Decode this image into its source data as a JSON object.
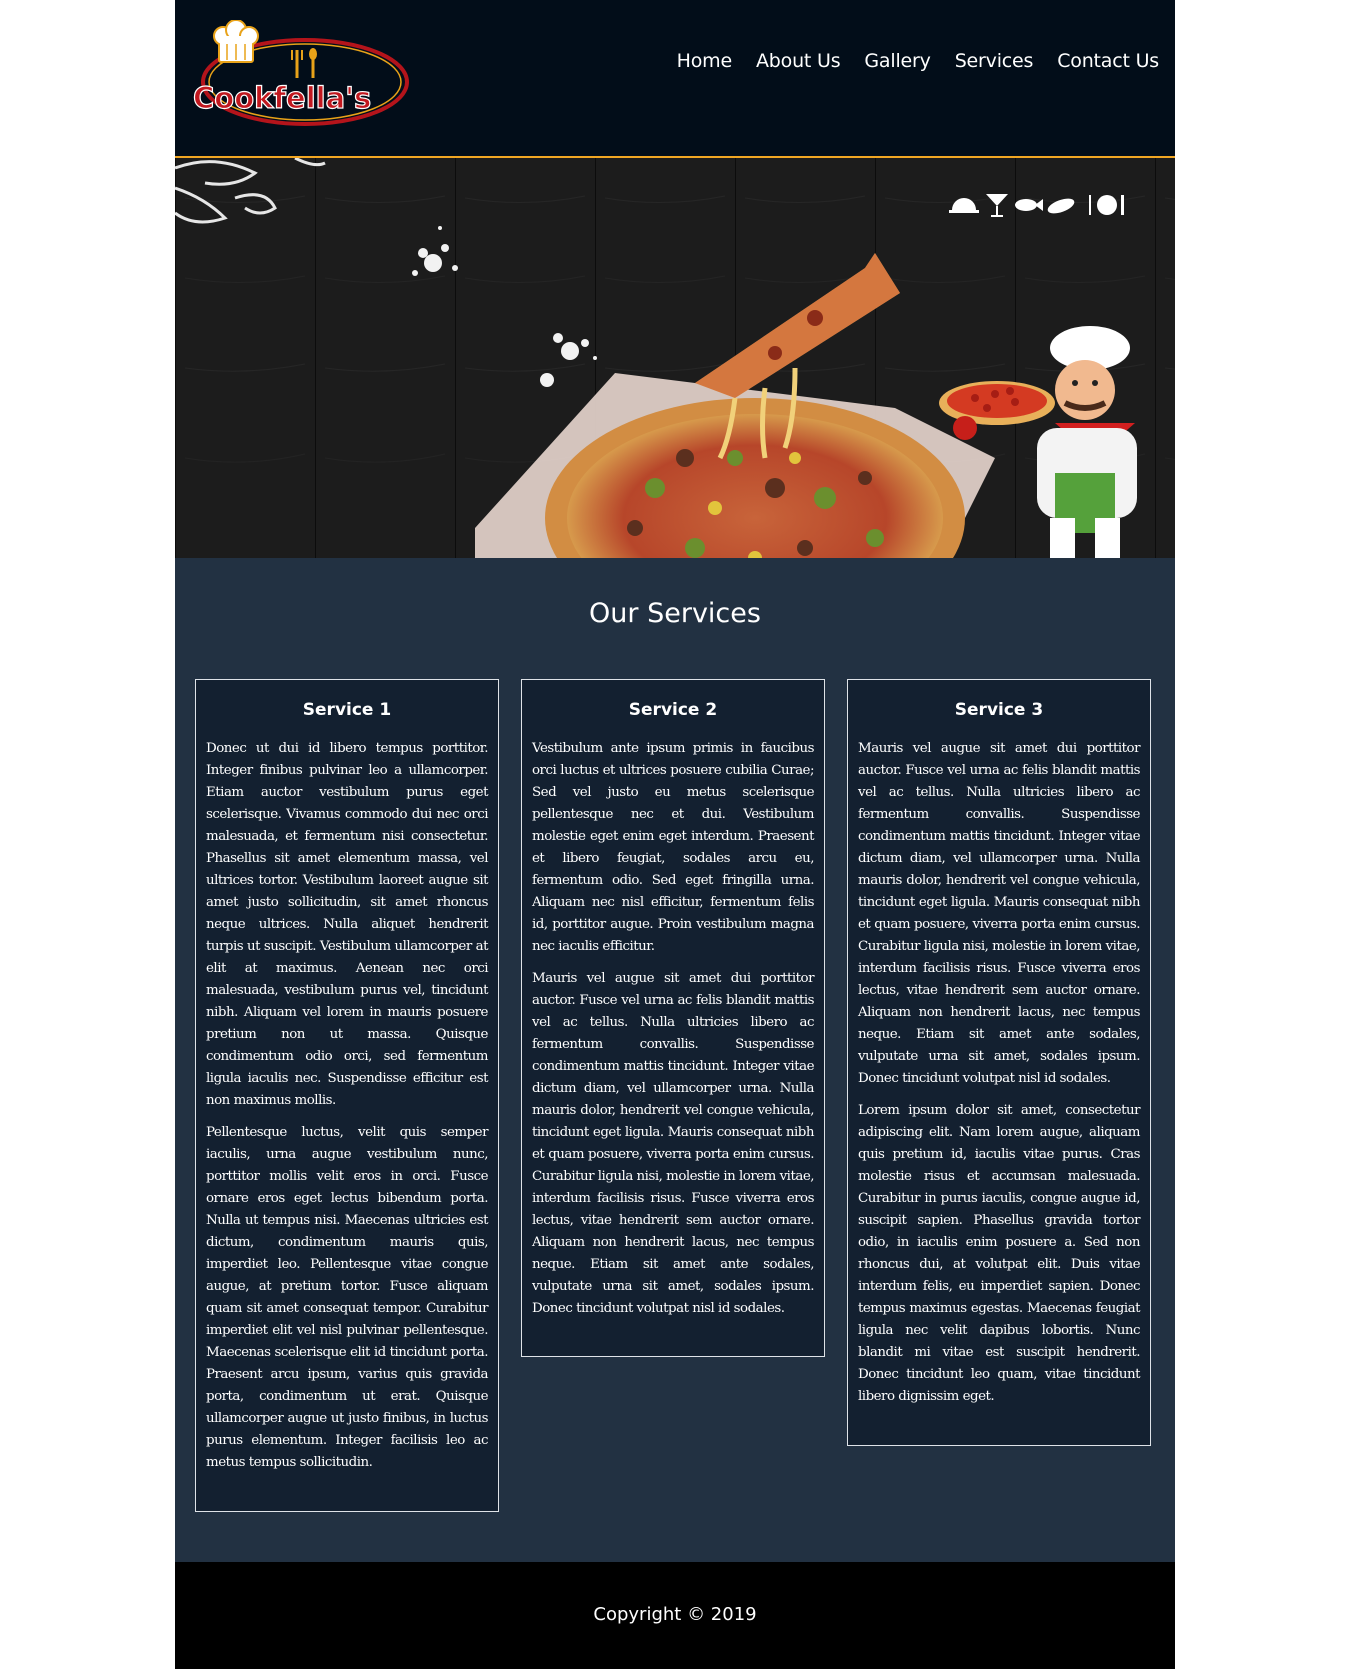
{
  "brand": {
    "logo_text": "Cookfella's"
  },
  "nav": {
    "items": [
      {
        "label": "Home"
      },
      {
        "label": "About Us"
      },
      {
        "label": "Gallery"
      },
      {
        "label": "Services"
      },
      {
        "label": "Contact Us"
      }
    ]
  },
  "hero": {
    "icons": [
      "cloche-icon",
      "cocktail-icon",
      "fish-icon",
      "leaf-dish-icon",
      "plate-cutlery-icon"
    ]
  },
  "services": {
    "title": "Our Services",
    "cards": [
      {
        "title": "Service 1",
        "paragraphs": [
          "Donec ut dui id libero tempus porttitor. Integer finibus pulvinar leo a ullamcorper. Etiam auctor vestibulum purus eget scelerisque. Vivamus commodo dui nec orci malesuada, et fermentum nisi consectetur. Phasellus sit amet elementum massa, vel ultrices tortor. Vestibulum laoreet augue sit amet justo sollicitudin, sit amet rhoncus neque ultrices. Nulla aliquet hendrerit turpis ut suscipit. Vestibulum ullamcorper at elit at maximus. Aenean nec orci malesuada, vestibulum purus vel, tincidunt nibh. Aliquam vel lorem in mauris posuere pretium non ut massa. Quisque condimentum odio orci, sed fermentum ligula iaculis nec. Suspendisse efficitur est non maximus mollis.",
          "Pellentesque luctus, velit quis semper iaculis, urna augue vestibulum nunc, porttitor mollis velit eros in orci. Fusce ornare eros eget lectus bibendum porta. Nulla ut tempus nisi. Maecenas ultricies est dictum, condimentum mauris quis, imperdiet leo. Pellentesque vitae congue augue, at pretium tortor. Fusce aliquam quam sit amet consequat tempor. Curabitur imperdiet elit vel nisl pulvinar pellentesque. Maecenas scelerisque elit id tincidunt porta. Praesent arcu ipsum, varius quis gravida porta, condimentum ut erat. Quisque ullamcorper augue ut justo finibus, in luctus purus elementum. Integer facilisis leo ac metus tempus sollicitudin."
        ]
      },
      {
        "title": "Service 2",
        "paragraphs": [
          "Vestibulum ante ipsum primis in faucibus orci luctus et ultrices posuere cubilia Curae; Sed vel justo eu metus scelerisque pellentesque nec et dui. Vestibulum molestie eget enim eget interdum. Praesent et libero feugiat, sodales arcu eu, fermentum odio. Sed eget fringilla urna. Aliquam nec nisl efficitur, fermentum felis id, porttitor augue. Proin vestibulum magna nec iaculis efficitur.",
          "Mauris vel augue sit amet dui porttitor auctor. Fusce vel urna ac felis blandit mattis vel ac tellus. Nulla ultricies libero ac fermentum convallis. Suspendisse condimentum mattis tincidunt. Integer vitae dictum diam, vel ullamcorper urna. Nulla mauris dolor, hendrerit vel congue vehicula, tincidunt eget ligula. Mauris consequat nibh et quam posuere, viverra porta enim cursus. Curabitur ligula nisi, molestie in lorem vitae, interdum facilisis risus. Fusce viverra eros lectus, vitae hendrerit sem auctor ornare. Aliquam non hendrerit lacus, nec tempus neque. Etiam sit amet ante sodales, vulputate urna sit amet, sodales ipsum. Donec tincidunt volutpat nisl id sodales."
        ]
      },
      {
        "title": "Service 3",
        "paragraphs": [
          "Mauris vel augue sit amet dui porttitor auctor. Fusce vel urna ac felis blandit mattis vel ac tellus. Nulla ultricies libero ac fermentum convallis. Suspendisse condimentum mattis tincidunt. Integer vitae dictum diam, vel ullamcorper urna. Nulla mauris dolor, hendrerit vel congue vehicula, tincidunt eget ligula. Mauris consequat nibh et quam posuere, viverra porta enim cursus. Curabitur ligula nisi, molestie in lorem vitae, interdum facilisis risus. Fusce viverra eros lectus, vitae hendrerit sem auctor ornare. Aliquam non hendrerit lacus, nec tempus neque. Etiam sit amet ante sodales, vulputate urna sit amet, sodales ipsum. Donec tincidunt volutpat nisl id sodales.",
          "Lorem ipsum dolor sit amet, consectetur adipiscing elit. Nam lorem augue, aliquam quis pretium id, iaculis vitae purus. Cras molestie risus et accumsan malesuada. Curabitur in purus iaculis, congue augue id, suscipit sapien. Phasellus gravida tortor odio, in iaculis enim posuere a. Sed non rhoncus dui, at volutpat elit. Duis vitae interdum felis, eu imperdiet sapien. Donec tempus maximus egestas. Maecenas feugiat ligula nec velit dapibus lobortis. Nunc blandit mi vitae est suscipit hendrerit. Donec tincidunt leo quam, vitae tincidunt libero dignissim eget."
        ]
      }
    ]
  },
  "footer": {
    "copyright": "Copyright © 2019"
  },
  "colors": {
    "header_bg": "#020d19",
    "accent_line": "#f0a623",
    "section_bg": "#223142",
    "card_bg": "#132030",
    "footer_bg": "#000000"
  }
}
